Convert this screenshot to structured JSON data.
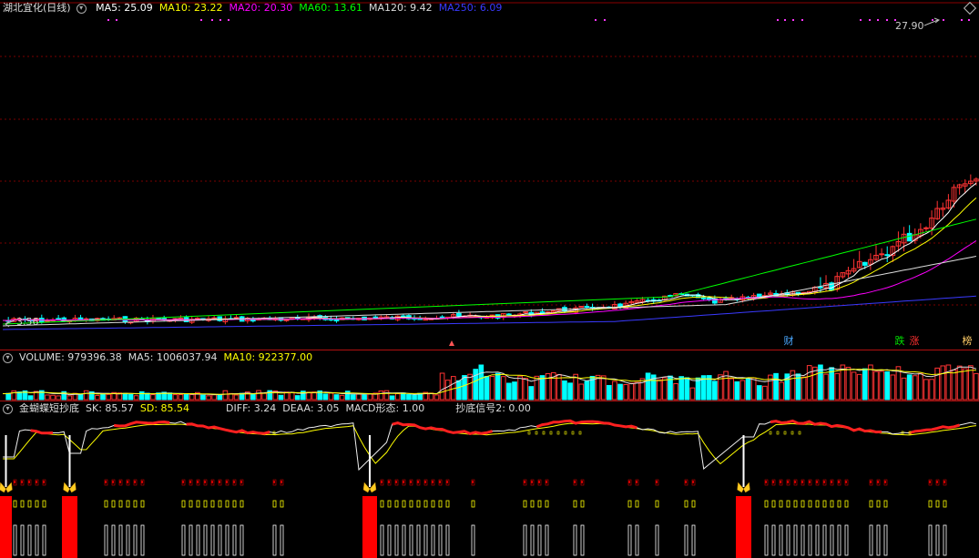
{
  "price_panel": {
    "title": "湖北宜化(日线)",
    "ma_legend": [
      {
        "label": "MA5: 25.09",
        "color": "#ffffff"
      },
      {
        "label": "MA10: 23.22",
        "color": "#ffff00"
      },
      {
        "label": "MA20: 20.30",
        "color": "#ff00ff"
      },
      {
        "label": "MA60: 13.61",
        "color": "#00ff00"
      },
      {
        "label": "MA120: 9.42",
        "color": "#dddddd"
      },
      {
        "label": "MA250: 6.09",
        "color": "#3a3aff"
      }
    ],
    "high_label": "27.90",
    "low_label": "3.56",
    "news_markers": [
      {
        "label": "财",
        "color": "#4aa8ff"
      },
      {
        "label": "跌",
        "color": "#00e000"
      },
      {
        "label": "涨",
        "color": "#ff3030"
      },
      {
        "label": "榜",
        "color": "#ffcc66"
      }
    ],
    "colors": {
      "up": "#ff3333",
      "down": "#00ffff",
      "grid": "#8a0000"
    }
  },
  "volume_panel": {
    "legend": [
      {
        "label": "VOLUME: 979396.38",
        "color": "#dddddd"
      },
      {
        "label": "MA5: 1006037.94",
        "color": "#dddddd"
      },
      {
        "label": "MA10: 922377.00",
        "color": "#ffff00"
      }
    ]
  },
  "indicator_panel": {
    "legend": [
      {
        "label": "金蝴蝶短抄底",
        "color": "#dddddd"
      },
      {
        "label": "SK: 85.57",
        "color": "#dddddd"
      },
      {
        "label": "SD: 85.54",
        "color": "#ffff00"
      },
      {
        "label": "DIFF: 3.24",
        "color": "#dddddd"
      },
      {
        "label": "DEAA: 3.05",
        "color": "#dddddd"
      },
      {
        "label": "MACD形态: 1.00",
        "color": "#dddddd"
      },
      {
        "label": "抄底信号2: 0.00",
        "color": "#dddddd"
      }
    ],
    "signal_icon": "butterfly-icon"
  }
}
